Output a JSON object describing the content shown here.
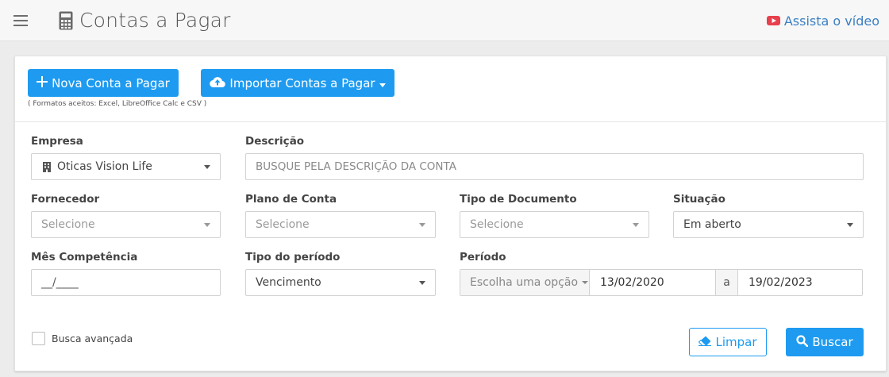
{
  "header": {
    "title": "Contas a Pagar",
    "video_link": "Assista o vídeo",
    "icons": {
      "menu": "hamburger-icon",
      "title": "calculator-icon",
      "video": "youtube-play-icon"
    },
    "accent_color": "#3b7fc4"
  },
  "actions": {
    "new_button": "Nova Conta a Pagar",
    "import_button": "Importar Contas a Pagar",
    "formats_note": "( Formatos aceitos: Excel, LibreOffice Calc e CSV )",
    "button_color": "#1e9bf0",
    "icons": {
      "new": "plus-icon",
      "import": "cloud-upload-icon",
      "import_menu": "caret-down-icon"
    }
  },
  "filters": {
    "empresa": {
      "label": "Empresa",
      "value": "Oticas Vision Life",
      "icon": "building-icon"
    },
    "descricao": {
      "label": "Descrição",
      "placeholder": "BUSQUE PELA DESCRIÇÃO DA CONTA"
    },
    "fornecedor": {
      "label": "Fornecedor",
      "placeholder": "Selecione"
    },
    "plano_conta": {
      "label": "Plano de Conta",
      "placeholder": "Selecione"
    },
    "tipo_documento": {
      "label": "Tipo de Documento",
      "placeholder": "Selecione"
    },
    "situacao": {
      "label": "Situação",
      "value": "Em aberto"
    },
    "mes_competencia": {
      "label": "Mês Competência",
      "value": "__/____"
    },
    "tipo_periodo": {
      "label": "Tipo do período",
      "value": "Vencimento"
    },
    "periodo": {
      "label": "Período",
      "option_placeholder": "Escolha uma opção",
      "start": "13/02/2020",
      "separator": "a",
      "end": "19/02/2023"
    }
  },
  "footer": {
    "advanced_search": "Busca avançada",
    "clear_button": "Limpar",
    "search_button": "Buscar",
    "icons": {
      "clear": "eraser-icon",
      "search": "search-icon"
    }
  }
}
